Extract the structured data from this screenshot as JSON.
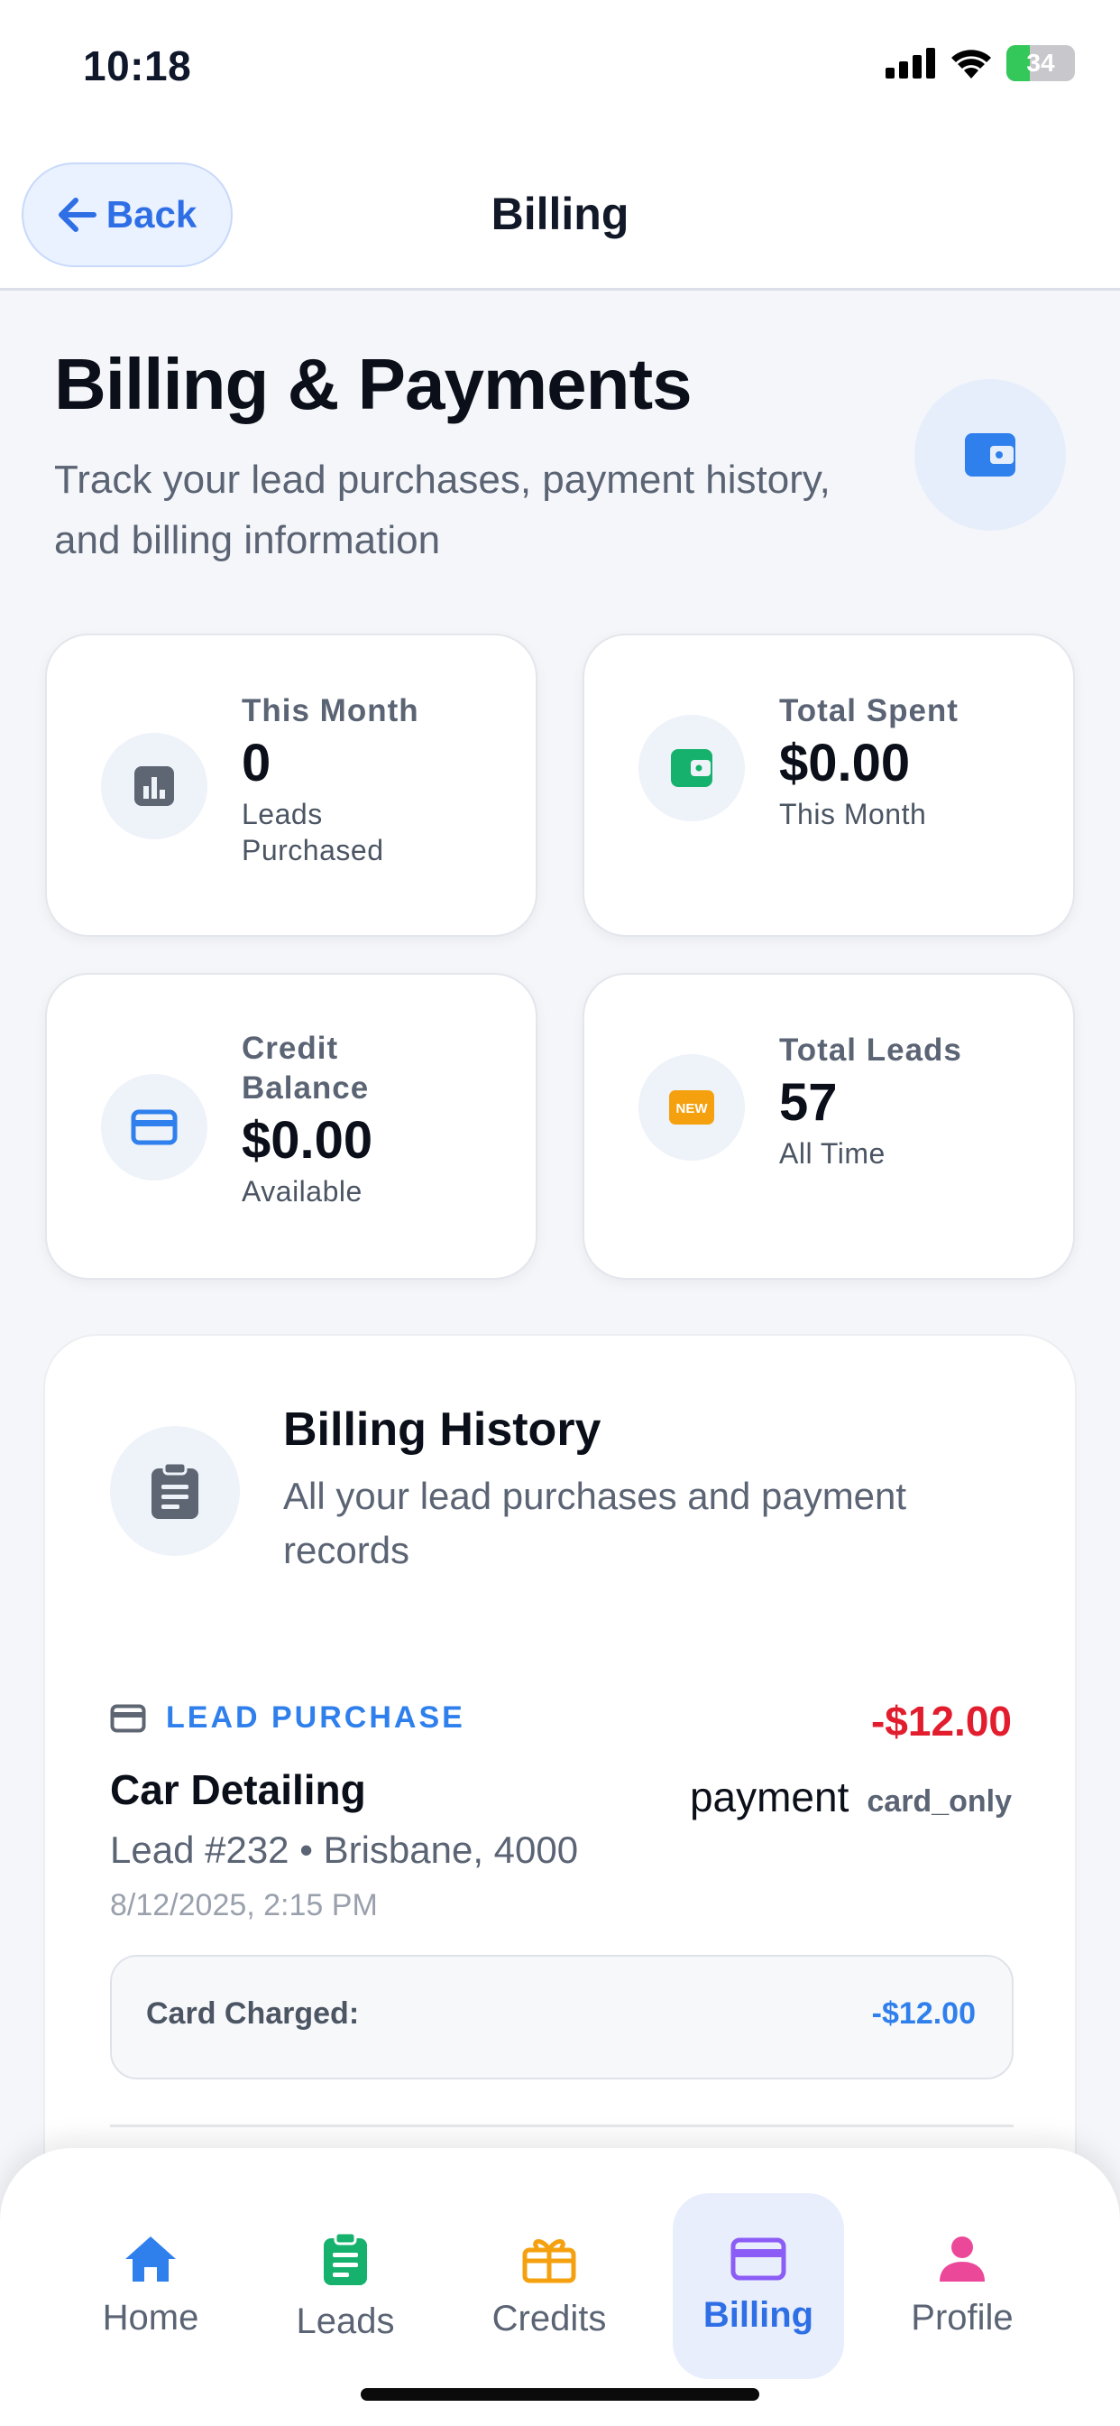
{
  "status": {
    "time": "10:18",
    "battery": "34",
    "battery_level": 0.34
  },
  "nav": {
    "back_label": "Back",
    "title": "Billing"
  },
  "header": {
    "title": "Billing & Payments",
    "subtitle": "Track your lead purchases, payment history, and billing information",
    "icon": "wallet-icon"
  },
  "stats": [
    {
      "label": "This Month",
      "value": "0",
      "sub": "Leads Purchased",
      "icon": "bar-chart-icon",
      "color": "#5f6673"
    },
    {
      "label": "Total Spent",
      "value": "$0.00",
      "sub": "This Month",
      "icon": "wallet-icon",
      "color": "#16b26d"
    },
    {
      "label": "Credit Balance",
      "value": "$0.00",
      "sub": "Available",
      "icon": "credit-card-icon",
      "color": "#2f80ed"
    },
    {
      "label": "Total Leads",
      "value": "57",
      "sub": "All Time",
      "icon": "new-badge-icon",
      "color": "#f5a10f",
      "badge_text": "NEW"
    }
  ],
  "history": {
    "title": "Billing History",
    "subtitle": "All your lead purchases and payment records",
    "icon": "clipboard-icon",
    "transactions": [
      {
        "type": "LEAD PURCHASE",
        "amount": "-$12.00",
        "name": "Car Detailing",
        "method_label": "payment",
        "method_value": "card_only",
        "detail": "Lead #232 • Brisbane, 4000",
        "date": "8/12/2025, 2:15 PM",
        "charge_label": "Card Charged:",
        "charge_value": "-$12.00"
      }
    ]
  },
  "tabs": [
    {
      "label": "Home",
      "icon": "home-icon",
      "color": "#2f80ed",
      "active": false
    },
    {
      "label": "Leads",
      "icon": "clipboard-icon",
      "color": "#16b26d",
      "active": false
    },
    {
      "label": "Credits",
      "icon": "gift-icon",
      "color": "#f5a10f",
      "active": false
    },
    {
      "label": "Billing",
      "icon": "credit-card-icon",
      "color": "#8b5cf6",
      "active": true
    },
    {
      "label": "Profile",
      "icon": "person-icon",
      "color": "#ec4899",
      "active": false
    }
  ]
}
